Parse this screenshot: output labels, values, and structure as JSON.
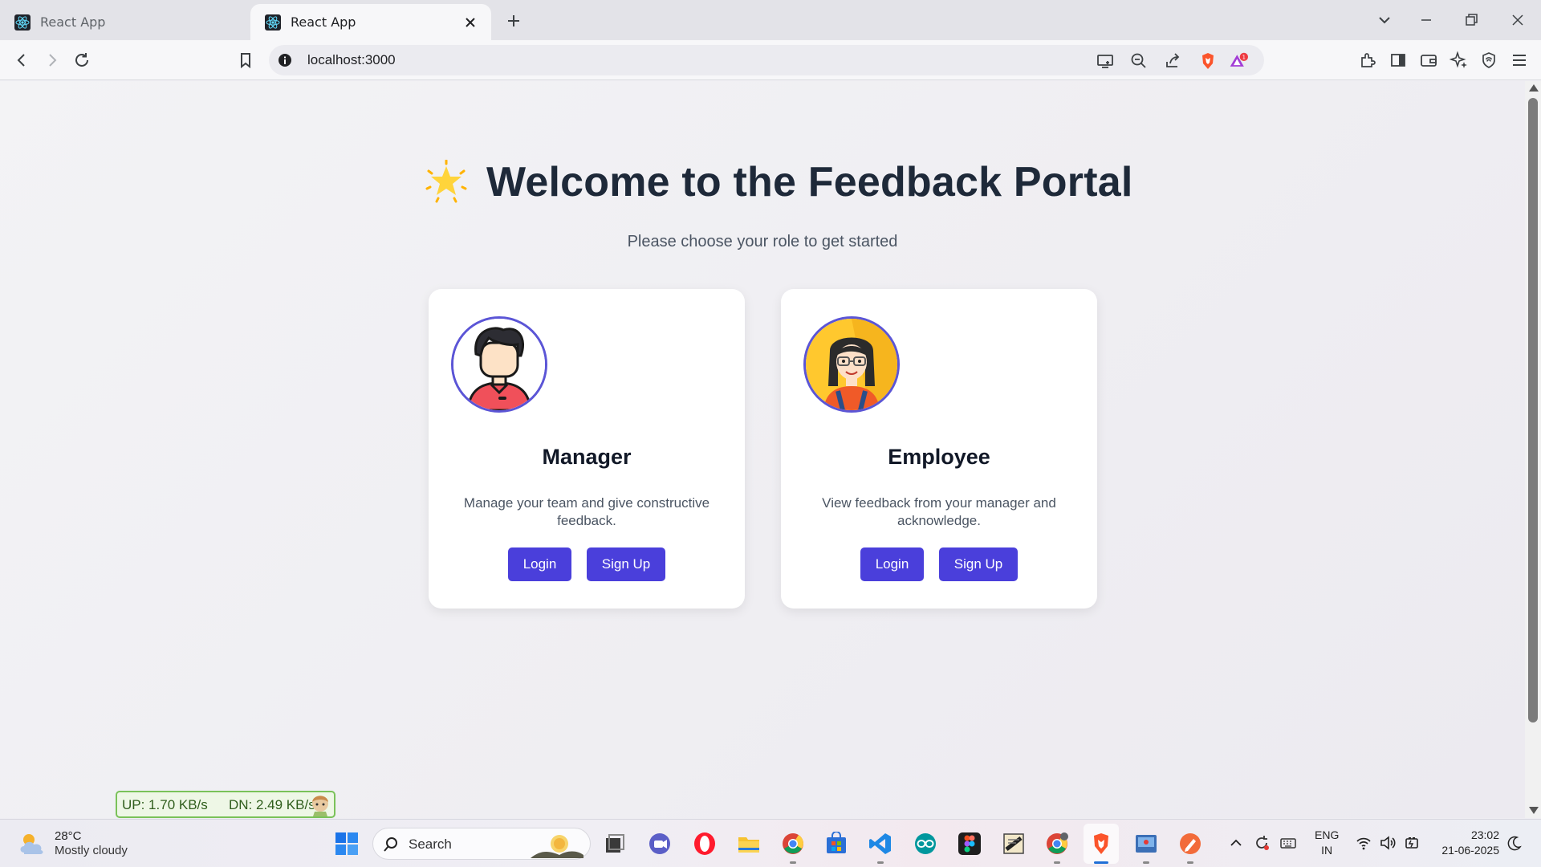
{
  "browser": {
    "tabs": [
      {
        "title": "React App",
        "active": false
      },
      {
        "title": "React App",
        "active": true
      }
    ],
    "url": "localhost:3000",
    "brave_rewards_badge": "1"
  },
  "page": {
    "heading": "Welcome to the Feedback Portal",
    "subtitle": "Please choose your role to get started",
    "cards": [
      {
        "role": "Manager",
        "description": "Manage your team and give constructive feedback.",
        "login_label": "Login",
        "signup_label": "Sign Up"
      },
      {
        "role": "Employee",
        "description": "View feedback from your manager and acknowledge.",
        "login_label": "Login",
        "signup_label": "Sign Up"
      }
    ],
    "accent_color": "#4a3fdb"
  },
  "netspeed": {
    "up": "UP: 1.70 KB/s",
    "down": "DN: 2.49 KB/s"
  },
  "taskbar": {
    "weather": {
      "temp": "28°C",
      "condition": "Mostly cloudy"
    },
    "search_placeholder": "Search",
    "language": {
      "line1": "ENG",
      "line2": "IN"
    },
    "time": "23:02",
    "date": "21-06-2025",
    "apps": [
      "start-icon",
      "task-view-icon",
      "teams-icon",
      "opera-icon",
      "file-explorer-icon",
      "chrome-icon",
      "store-icon",
      "vscode-icon",
      "arduino-icon",
      "figma-icon",
      "certificate-app-icon",
      "chrome-profile-icon",
      "brave-icon",
      "screen-recorder-icon",
      "sketch-app-icon"
    ]
  }
}
